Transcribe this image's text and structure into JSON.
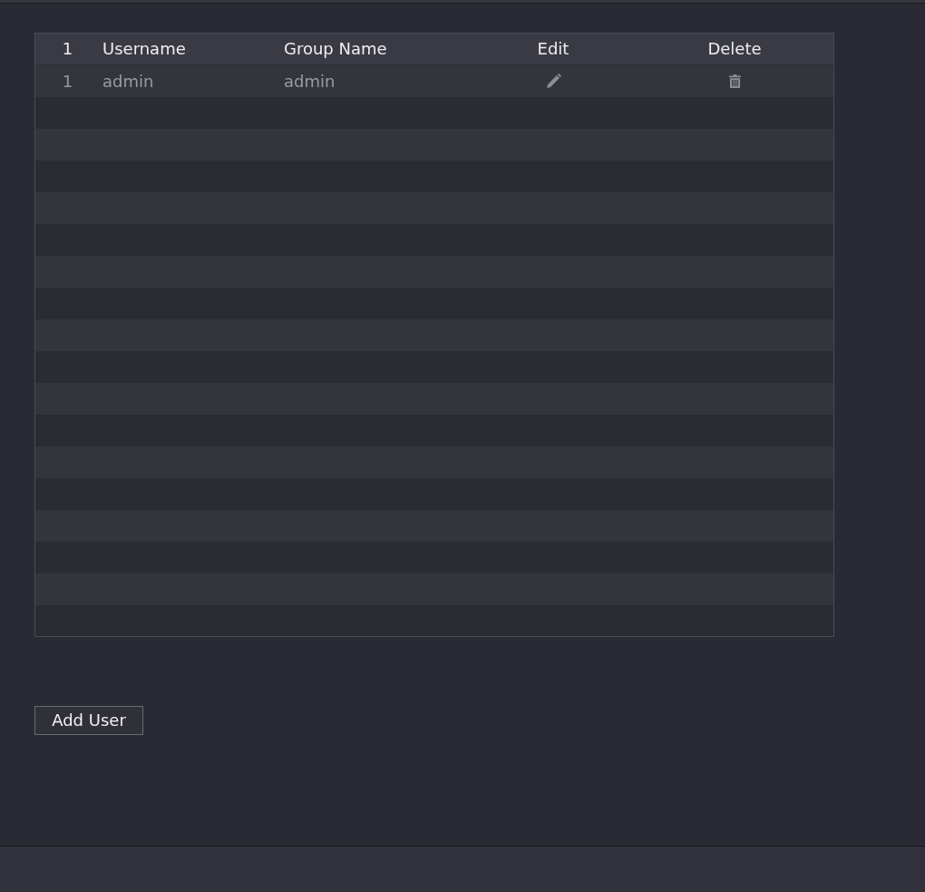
{
  "table": {
    "columns": [
      {
        "label": "1"
      },
      {
        "label": "Username"
      },
      {
        "label": "Group Name"
      },
      {
        "label": "Edit"
      },
      {
        "label": "Delete"
      }
    ],
    "rows": [
      {
        "index": "1",
        "username": "admin",
        "group_name": "admin"
      }
    ]
  },
  "add_user_button": {
    "label": "Add User"
  }
}
